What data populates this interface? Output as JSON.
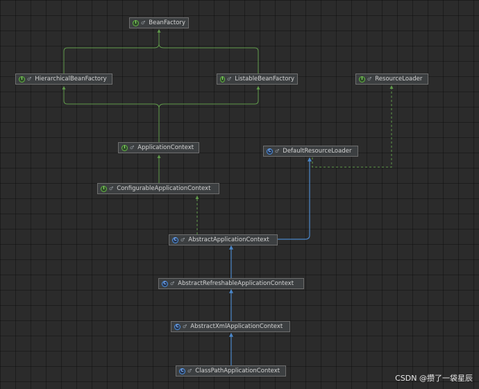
{
  "nodes": [
    {
      "id": "bean-factory",
      "label": "BeanFactory",
      "kind": "interface"
    },
    {
      "id": "hierarchical-bean-factory",
      "label": "HierarchicalBeanFactory",
      "kind": "interface"
    },
    {
      "id": "listable-bean-factory",
      "label": "ListableBeanFactory",
      "kind": "interface"
    },
    {
      "id": "resource-loader",
      "label": "ResourceLoader",
      "kind": "interface"
    },
    {
      "id": "application-context",
      "label": "ApplicationContext",
      "kind": "interface"
    },
    {
      "id": "default-resource-loader",
      "label": "DefaultResourceLoader",
      "kind": "class"
    },
    {
      "id": "configurable-application-context",
      "label": "ConfigurableApplicationContext",
      "kind": "interface"
    },
    {
      "id": "abstract-application-context",
      "label": "AbstractApplicationContext",
      "kind": "abstract-class"
    },
    {
      "id": "abstract-refreshable-application-context",
      "label": "AbstractRefreshableApplicationContext",
      "kind": "abstract-class"
    },
    {
      "id": "abstract-xml-application-context",
      "label": "AbstractXmlApplicationContext",
      "kind": "abstract-class"
    },
    {
      "id": "class-path-application-context",
      "label": "ClassPathApplicationContext",
      "kind": "class"
    }
  ],
  "edges": [
    {
      "from": "hierarchical-bean-factory",
      "to": "bean-factory",
      "type": "extends-interface"
    },
    {
      "from": "listable-bean-factory",
      "to": "bean-factory",
      "type": "extends-interface"
    },
    {
      "from": "application-context",
      "to": "hierarchical-bean-factory",
      "type": "extends-interface"
    },
    {
      "from": "application-context",
      "to": "listable-bean-factory",
      "type": "extends-interface"
    },
    {
      "from": "configurable-application-context",
      "to": "application-context",
      "type": "extends-interface"
    },
    {
      "from": "default-resource-loader",
      "to": "resource-loader",
      "type": "implements"
    },
    {
      "from": "abstract-application-context",
      "to": "configurable-application-context",
      "type": "implements"
    },
    {
      "from": "abstract-application-context",
      "to": "default-resource-loader",
      "type": "extends-class"
    },
    {
      "from": "abstract-refreshable-application-context",
      "to": "abstract-application-context",
      "type": "extends-class"
    },
    {
      "from": "abstract-xml-application-context",
      "to": "abstract-refreshable-application-context",
      "type": "extends-class"
    },
    {
      "from": "class-path-application-context",
      "to": "abstract-xml-application-context",
      "type": "extends-class"
    }
  ],
  "icon_letters": {
    "interface": "I",
    "class": "C",
    "abstract-class": "C"
  },
  "visibility_mark": "♂",
  "colors": {
    "interface_edge": "#5f9a4a",
    "implements_edge": "#5f9a4a",
    "class_edge": "#4a86c8",
    "background": "#2b2b2b",
    "node_bg": "#3c3f41"
  },
  "watermark": "CSDN @攒了一袋星辰"
}
